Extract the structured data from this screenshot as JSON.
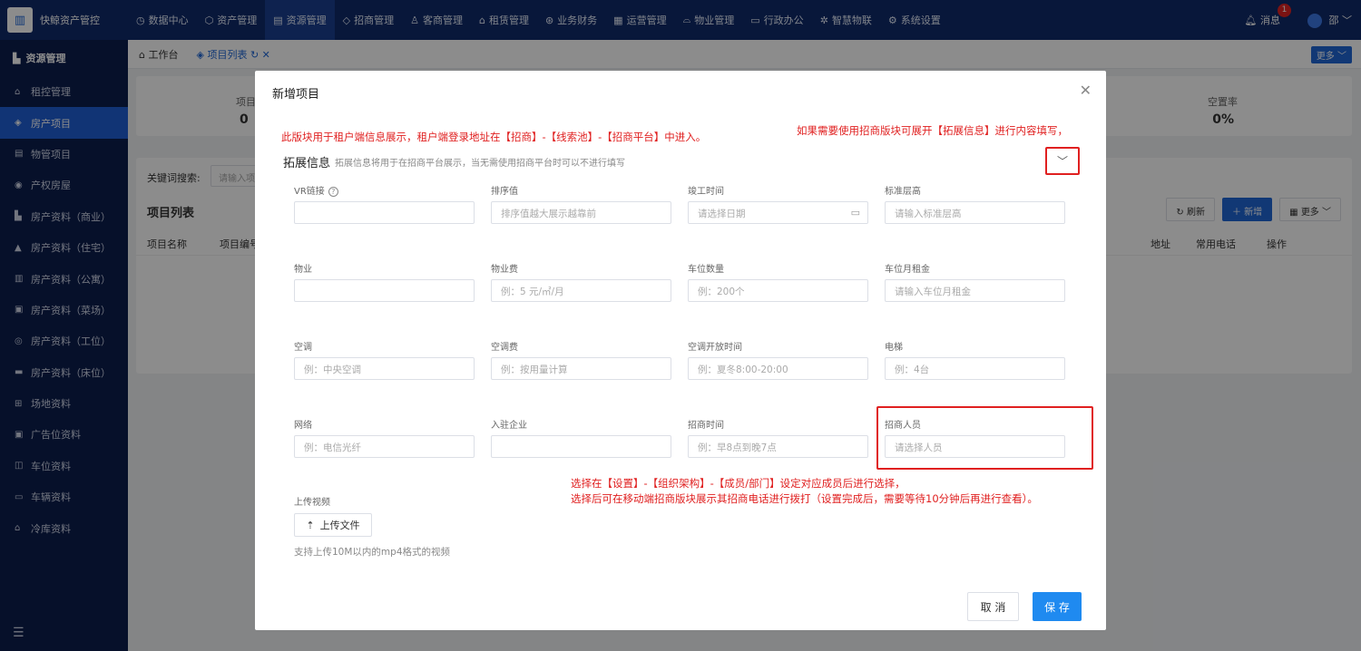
{
  "app": {
    "name": "快鲸资产管控",
    "logo_icon": "building-icon"
  },
  "top_menu": [
    {
      "label": "数据中心",
      "icon": "◷"
    },
    {
      "label": "资产管理",
      "icon": "⬡"
    },
    {
      "label": "资源管理",
      "icon": "▤",
      "active": true
    },
    {
      "label": "招商管理",
      "icon": "◇"
    },
    {
      "label": "客商管理",
      "icon": "♙"
    },
    {
      "label": "租赁管理",
      "icon": "⌂"
    },
    {
      "label": "业务财务",
      "icon": "⊛"
    },
    {
      "label": "运营管理",
      "icon": "▦"
    },
    {
      "label": "物业管理",
      "icon": "⌓"
    },
    {
      "label": "行政办公",
      "icon": "▭"
    },
    {
      "label": "智慧物联",
      "icon": "✲"
    },
    {
      "label": "系统设置",
      "icon": "⚙"
    }
  ],
  "top_right": {
    "messages_label": "消息",
    "messages_count": "1",
    "user_label": "邵"
  },
  "sidebar": {
    "header": "资源管理",
    "items": [
      {
        "label": "租控管理",
        "icon": "⌂"
      },
      {
        "label": "房产项目",
        "icon": "◈",
        "active": true
      },
      {
        "label": "物管项目",
        "icon": "▤"
      },
      {
        "label": "产权房屋",
        "icon": "◉"
      },
      {
        "label": "房产资料（商业）",
        "icon": "▙"
      },
      {
        "label": "房产资料（住宅）",
        "icon": "▲"
      },
      {
        "label": "房产资料（公寓）",
        "icon": "▥"
      },
      {
        "label": "房产资料（菜场）",
        "icon": "▣"
      },
      {
        "label": "房产资料（工位）",
        "icon": "◎"
      },
      {
        "label": "房产资料（床位）",
        "icon": "▬"
      },
      {
        "label": "场地资料",
        "icon": "⊞"
      },
      {
        "label": "广告位资料",
        "icon": "▣"
      },
      {
        "label": "车位资料",
        "icon": "◫"
      },
      {
        "label": "车辆资料",
        "icon": "▭"
      },
      {
        "label": "冷库资料",
        "icon": "⌂"
      }
    ],
    "footer_icon": "☰"
  },
  "tabs": [
    {
      "label": "工作台",
      "icon": "⌂"
    },
    {
      "label": "项目列表",
      "icon": "◈",
      "active": true
    }
  ],
  "tab_more": "更多",
  "background": {
    "stat_left_label": "项目",
    "stat_left_value": "0",
    "stat_right_label": "空置率",
    "stat_right_value": "0%",
    "keyword_label": "关键词搜索:",
    "keyword_placeholder": "请输入项",
    "list_title": "项目列表",
    "btn_refresh": "刷新",
    "btn_add": "新增",
    "btn_more": "更多",
    "col_name": "项目名称",
    "col_code": "项目编号",
    "col_address": "地址",
    "col_phone": "常用电话",
    "col_action": "操作"
  },
  "dialog": {
    "title": "新增项目",
    "note_top_left": "此版块用于租户端信息展示，租户端登录地址在【招商】-【线索池】-【招商平台】中进入。",
    "note_top_right": "如果需要使用招商版块可展开【拓展信息】进行内容填写，",
    "section_title": "拓展信息",
    "section_desc": "拓展信息将用于在招商平台展示，当无需使用招商平台时可以不进行填写",
    "fields": [
      {
        "label": "VR链接",
        "placeholder": "",
        "help": true
      },
      {
        "label": "排序值",
        "placeholder": "排序值越大展示越靠前"
      },
      {
        "label": "竣工时间",
        "placeholder": "请选择日期",
        "calendar": true
      },
      {
        "label": "标准层高",
        "placeholder": "请输入标准层高"
      },
      {
        "label": "物业",
        "placeholder": ""
      },
      {
        "label": "物业费",
        "placeholder": "例：5 元/㎡/月"
      },
      {
        "label": "车位数量",
        "placeholder": "例：200个"
      },
      {
        "label": "车位月租金",
        "placeholder": "请输入车位月租金"
      },
      {
        "label": "空调",
        "placeholder": "例：中央空调"
      },
      {
        "label": "空调费",
        "placeholder": "例：按用量计算"
      },
      {
        "label": "空调开放时间",
        "placeholder": "例：夏冬8:00-20:00"
      },
      {
        "label": "电梯",
        "placeholder": "例：4台"
      },
      {
        "label": "网络",
        "placeholder": "例：电信光纤"
      },
      {
        "label": "入驻企业",
        "placeholder": ""
      },
      {
        "label": "招商时间",
        "placeholder": "例：早8点到晚7点"
      },
      {
        "label": "招商人员",
        "placeholder": "请选择人员"
      }
    ],
    "note_bottom_1": "选择在【设置】-【组织架构】-【成员/部门】设定对应成员后进行选择，",
    "note_bottom_2": "选择后可在移动端招商版块展示其招商电话进行拨打（设置完成后，需要等待10分钟后再进行查看）。",
    "upload_label": "上传视频",
    "upload_button": "上传文件",
    "upload_tip": "支持上传10M以内的mp4格式的视频",
    "cancel": "取 消",
    "save": "保 存"
  },
  "colors": {
    "accent": "#1f66d6",
    "annotation_red": "#e02020",
    "topbar": "#0f2a6b",
    "sidebar": "#0c1e4e"
  }
}
